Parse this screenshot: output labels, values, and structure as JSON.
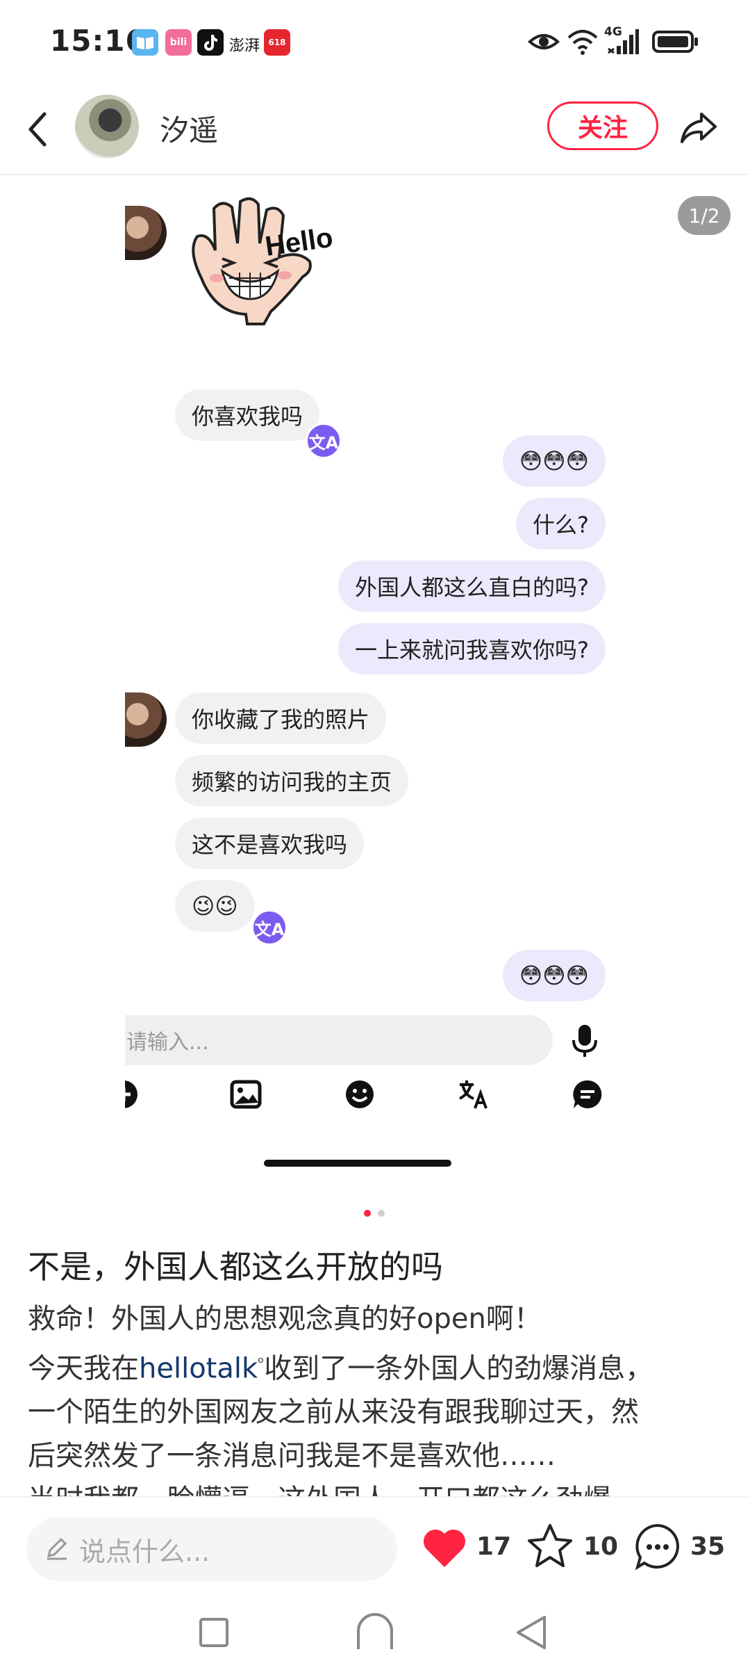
{
  "status_bar": {
    "time": "15:16",
    "network": "4G",
    "app_icons": [
      "book-app-icon",
      "bilibili-app-icon",
      "tiktok-app-icon",
      "thepaper-app-icon",
      "shopping-618-app-icon"
    ],
    "thepaper_label": "澎湃",
    "bilibili_label": "bili",
    "shopping_label": "618"
  },
  "header": {
    "author_name": "汐遥",
    "follow_label": "关注"
  },
  "image": {
    "page_counter": "1/2",
    "sticker_text": "Hello",
    "messages": [
      {
        "side": "in",
        "text": "你喜欢我吗"
      },
      {
        "side": "out",
        "text": "😳😳😳"
      },
      {
        "side": "out",
        "text": "什么?"
      },
      {
        "side": "out",
        "text": "外国人都这么直白的吗?"
      },
      {
        "side": "out",
        "text": "一上来就问我喜欢你吗?"
      },
      {
        "side": "in",
        "text": "你收藏了我的照片"
      },
      {
        "side": "in",
        "text": "频繁的访问我的主页"
      },
      {
        "side": "in",
        "text": "这不是喜欢我吗"
      },
      {
        "side": "in",
        "text": "😉😉"
      },
      {
        "side": "out",
        "text": "😳😳😳"
      }
    ],
    "translate_badge": "文A",
    "chat_input_placeholder": "请输入..."
  },
  "post": {
    "title": "不是，外国人都这么开放的吗",
    "body_lines": [
      "救命！外国人的思想观念真的好open啊！",
      "今天我在",
      "收到了一条外国人的劲爆消息，",
      "一个陌生的外国网友之前从来没有跟我聊过天，然",
      "后突然发了一条消息问我是不是喜欢他……",
      "当时我都一脸懵逼，这外国人一开口都这么劲爆"
    ],
    "tag_link": "hellotalk"
  },
  "bottom_bar": {
    "comment_placeholder": "说点什么...",
    "like_count": "17",
    "favorite_count": "10",
    "comment_count": "35"
  },
  "colors": {
    "accent": "#ff2442",
    "outgoing_bubble": "#ede9fc",
    "incoming_bubble": "#f1f1f1",
    "translate_badge": "#7b5cf0"
  }
}
